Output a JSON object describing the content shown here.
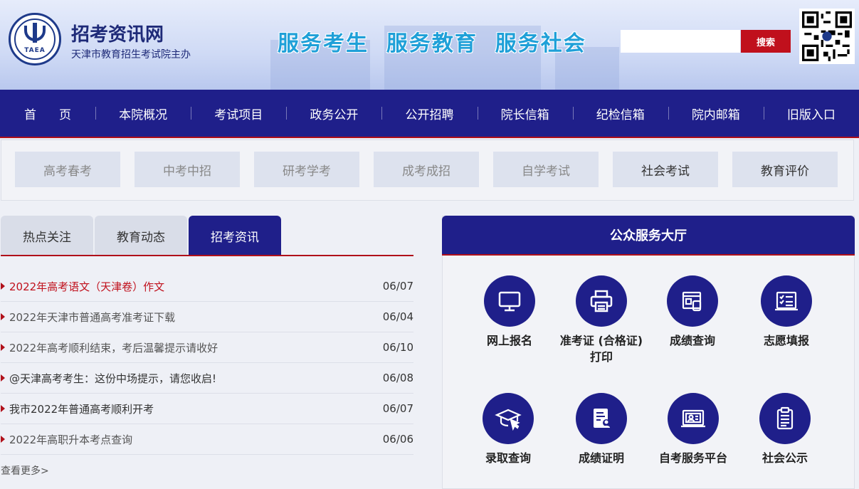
{
  "header": {
    "title": "招考资讯网",
    "subtitle": "天津市教育招生考试院主办",
    "logo_text": "TAEA",
    "slogan": "服务考生  服务教育  服务社会",
    "search_placeholder": "",
    "search_button": "搜索"
  },
  "nav": [
    "首页",
    "本院概况",
    "考试项目",
    "政务公开",
    "公开招聘",
    "院长信箱",
    "纪检信箱",
    "院内邮箱",
    "旧版入口"
  ],
  "categories": [
    "高考春考",
    "中考中招",
    "研考学考",
    "成考成招",
    "自学考试",
    "社会考试",
    "教育评价"
  ],
  "tabs": [
    "热点关注",
    "教育动态",
    "招考资讯"
  ],
  "news": [
    {
      "title": "2022年高考语文（天津卷）作文",
      "date": "06/07"
    },
    {
      "title": "2022年天津市普通高考准考证下载",
      "date": "06/04"
    },
    {
      "title": "2022年高考顺利结束，考后温馨提示请收好",
      "date": "06/10"
    },
    {
      "title": "@天津高考考生：这份中场提示，请您收启!",
      "date": "06/08"
    },
    {
      "title": "我市2022年普通高考顺利开考",
      "date": "06/07"
    },
    {
      "title": "2022年高职升本考点查询",
      "date": "06/06"
    }
  ],
  "more": "查看更多>",
  "hall": {
    "title": "公众服务大厅",
    "services": [
      {
        "label": "网上报名",
        "icon": "monitor-icon"
      },
      {
        "label": "准考证 (合格证) 打印",
        "icon": "printer-icon"
      },
      {
        "label": "成绩查询",
        "icon": "score-search-icon"
      },
      {
        "label": "志愿填报",
        "icon": "form-icon"
      },
      {
        "label": "录取查询",
        "icon": "graduation-cap-icon"
      },
      {
        "label": "成绩证明",
        "icon": "certificate-icon"
      },
      {
        "label": "自考服务平台",
        "icon": "id-card-icon"
      },
      {
        "label": "社会公示",
        "icon": "clipboard-icon"
      }
    ]
  }
}
